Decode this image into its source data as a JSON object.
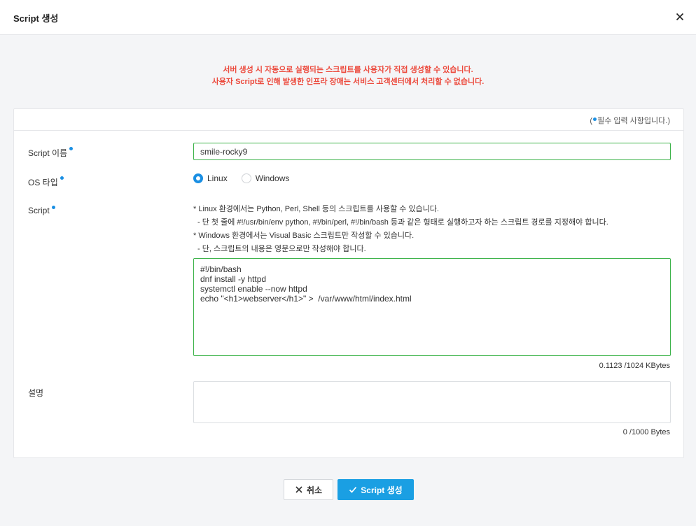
{
  "modal": {
    "title": "Script 생성"
  },
  "notice": {
    "line1": "서버 생성 시 자동으로 실행되는 스크립트를 사용자가 직접 생성할 수 있습니다.",
    "line2": "사용자 Script로 인해 발생한 인프라 장애는 서비스 고객센터에서 처리할 수 없습니다."
  },
  "required_note": {
    "open": "(",
    "text": "필수 입력 사항입니다.)"
  },
  "fields": {
    "name": {
      "label": "Script 이름",
      "value": "smile-rocky9"
    },
    "os": {
      "label": "OS 타입",
      "options": [
        "Linux",
        "Windows"
      ],
      "selected": "Linux"
    },
    "script": {
      "label": "Script",
      "help": [
        "* Linux 환경에서는 Python, Perl, Shell 등의 스크립트를 사용할 수 있습니다.",
        "  - 단 첫 줄에 #!/usr/bin/env python, #!/bin/perl, #!/bin/bash 등과 같은 형태로 실행하고자 하는 스크립트 경로를 지정해야 합니다.",
        "* Windows 환경에서는 Visual Basic 스크립트만 작성할 수 있습니다.",
        "  - 단, 스크립트의 내용은 영문으로만 작성해야 합니다."
      ],
      "value": "#!/bin/bash\ndnf install -y httpd\nsystemctl enable --now httpd\necho \"<h1>webserver</h1>\" >  /var/www/html/index.html",
      "counter": "0.1123 /1024 KBytes"
    },
    "description": {
      "label": "설명",
      "value": "",
      "counter": "0 /1000 Bytes"
    }
  },
  "buttons": {
    "cancel": "취소",
    "create": "Script 생성"
  },
  "colors": {
    "accent": "#1a9fe3",
    "warning": "#ec4a3d",
    "valid_border": "#3db34a"
  }
}
